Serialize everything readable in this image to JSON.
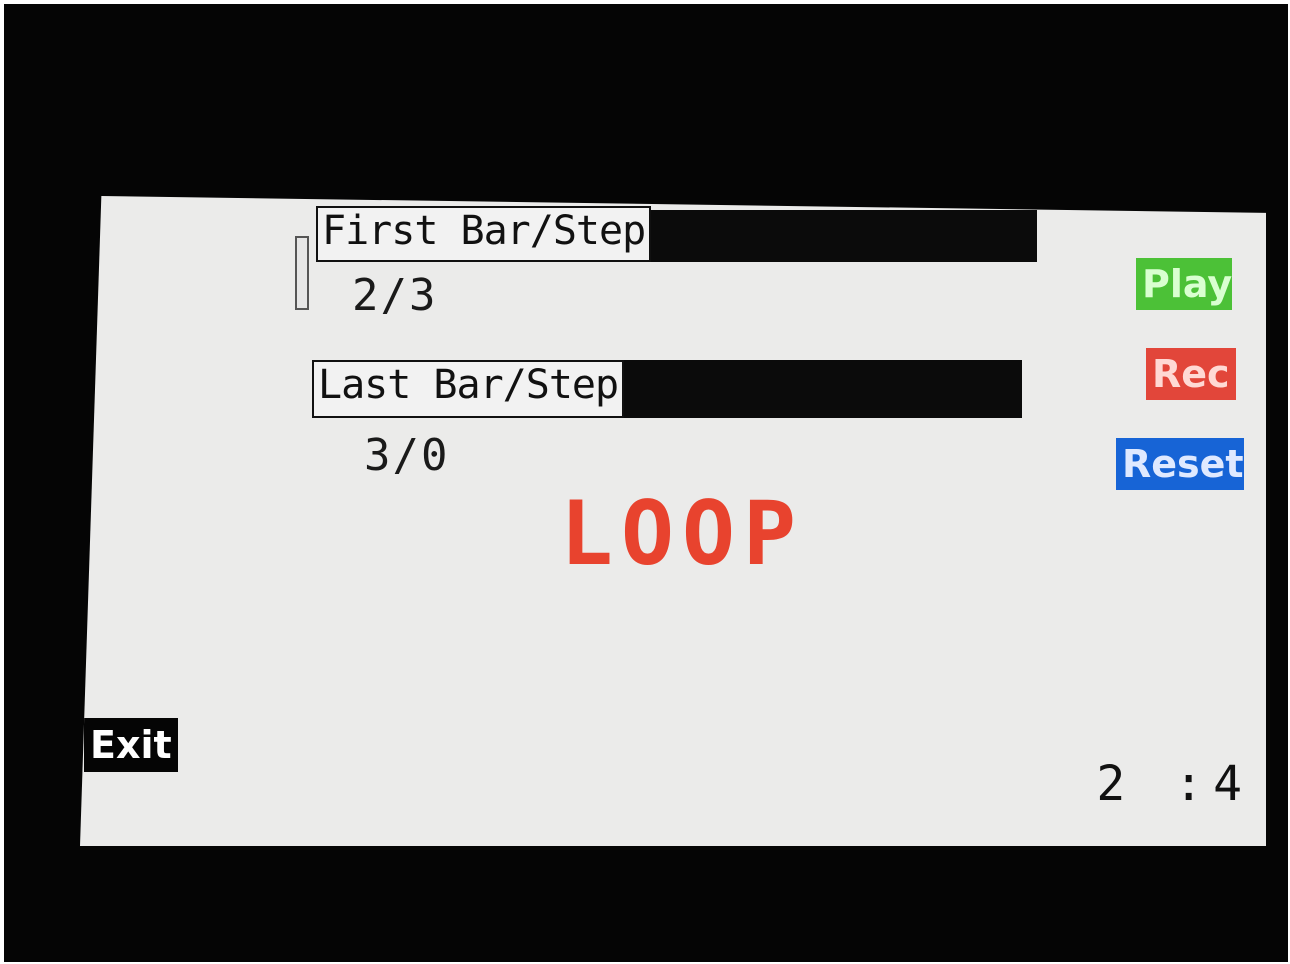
{
  "screen": {
    "first_label": "First Bar/Step",
    "first_value": "2/3",
    "last_label": "Last Bar/Step",
    "last_value": "3/0",
    "mode_label": "LOOP",
    "position": "2 :4"
  },
  "buttons": {
    "play": "Play",
    "rec": "Rec",
    "reset": "Reset",
    "exit": "Exit"
  },
  "colors": {
    "play": "#4cc137",
    "rec": "#e2463a",
    "reset": "#1764d6",
    "loop": "#e8432e"
  }
}
